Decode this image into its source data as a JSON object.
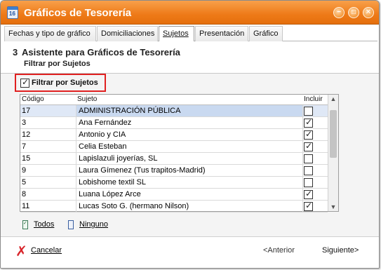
{
  "window": {
    "title": "Gráficos de Tesorería",
    "icon_number": "16",
    "controls": {
      "minimize": "−",
      "maximize": "□",
      "close": "✕"
    }
  },
  "tabs": [
    {
      "label": "Fechas y tipo de gráfico",
      "active": false
    },
    {
      "label": "Domiciliaciones",
      "active": false
    },
    {
      "label": "Sujetos",
      "active": true
    },
    {
      "label": "Presentación",
      "active": false
    },
    {
      "label": "Gráfico",
      "active": false
    }
  ],
  "header": {
    "step": "3",
    "title": "Asistente para Gráficos de Tesorería",
    "subtitle": "Filtrar por Sujetos"
  },
  "filter": {
    "label": "Filtrar por Sujetos",
    "checked": true,
    "check_glyph": "✓"
  },
  "grid": {
    "columns": {
      "codigo": "Código",
      "sujeto": "Sujeto",
      "incluir": "Incluir"
    },
    "rows": [
      {
        "codigo": "17",
        "sujeto": "ADMINISTRACIÓN PÚBLICA",
        "incluir": false,
        "check": ""
      },
      {
        "codigo": "3",
        "sujeto": "Ana Fernández",
        "incluir": true,
        "check": "✓"
      },
      {
        "codigo": "12",
        "sujeto": "Antonio y CIA",
        "incluir": true,
        "check": "✓"
      },
      {
        "codigo": "7",
        "sujeto": "Celia Esteban",
        "incluir": true,
        "check": "✓"
      },
      {
        "codigo": "15",
        "sujeto": "Lapislazuli joyerías, SL",
        "incluir": false,
        "check": ""
      },
      {
        "codigo": "9",
        "sujeto": "Laura Gímenez (Tus trapitos-Madrid)",
        "incluir": false,
        "check": ""
      },
      {
        "codigo": "5",
        "sujeto": "Lobishome textil SL",
        "incluir": false,
        "check": ""
      },
      {
        "codigo": "8",
        "sujeto": "Luana López Arce",
        "incluir": true,
        "check": "✓"
      },
      {
        "codigo": "11",
        "sujeto": "Lucas Soto G. (hermano Nilson)",
        "incluir": true,
        "check": "✓"
      }
    ],
    "scroll_up": "▲",
    "scroll_down": "▼"
  },
  "selection": {
    "all": {
      "label": "Todos",
      "icon": "check-all-icon"
    },
    "none": {
      "label": "Ninguno",
      "icon": "uncheck-all-icon"
    }
  },
  "footer": {
    "cancel": "Cancelar",
    "cancel_icon": "✗",
    "previous": "<Anterior",
    "next": "Siguiente>"
  },
  "colors": {
    "titlebar": "#ee7a18",
    "highlight_border": "#e02020",
    "selected_row": "#c9d9f0",
    "cancel_icon": "#d8262c"
  }
}
